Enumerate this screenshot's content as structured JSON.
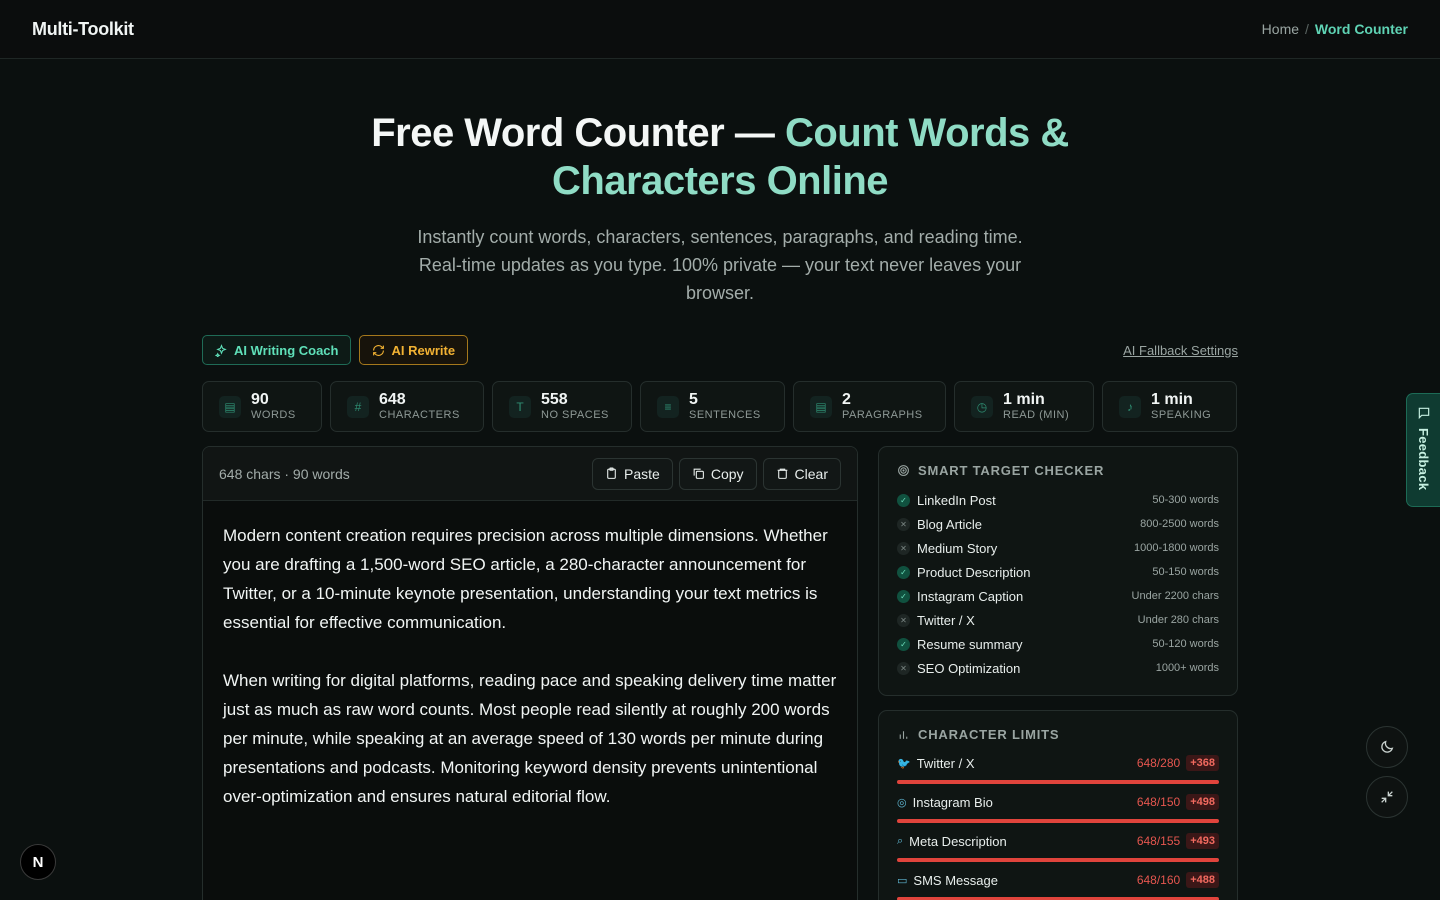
{
  "app": {
    "brand": "Multi-Toolkit"
  },
  "breadcrumb": {
    "home": "Home",
    "separator": "/",
    "current": "Word Counter"
  },
  "hero": {
    "title_main": "Free Word Counter — ",
    "title_accent": "Count Words & Characters Online",
    "subtitle": "Instantly count words, characters, sentences, paragraphs, and reading time. Real-time updates as you type. 100% private — your text never leaves your browser."
  },
  "actions": {
    "coach_label": "AI Writing Coach",
    "rewrite_label": "AI Rewrite",
    "fallback_label": "AI Fallback Settings"
  },
  "stats": [
    {
      "icon": "document-icon",
      "glyph": "▤",
      "value": "90",
      "label": "WORDS"
    },
    {
      "icon": "hash-icon",
      "glyph": "#",
      "value": "648",
      "label": "CHARACTERS"
    },
    {
      "icon": "type-icon",
      "glyph": "T",
      "value": "558",
      "label": "NO SPACES"
    },
    {
      "icon": "lines-icon",
      "glyph": "≡",
      "value": "5",
      "label": "SENTENCES"
    },
    {
      "icon": "paragraph-icon",
      "glyph": "▤",
      "value": "2",
      "label": "PARAGRAPHS"
    },
    {
      "icon": "clock-icon",
      "glyph": "◷",
      "value": "1 min",
      "label": "READ (MIN)"
    },
    {
      "icon": "mic-icon",
      "glyph": "♪",
      "value": "1 min",
      "label": "SPEAKING"
    }
  ],
  "editor": {
    "meta": "648 chars · 90 words",
    "paste_label": "Paste",
    "copy_label": "Copy",
    "clear_label": "Clear",
    "paragraphs": [
      "Modern content creation requires precision across multiple dimensions. Whether you are drafting a 1,500-word SEO article, a 280-character announcement for Twitter, or a 10-minute keynote presentation, understanding your text metrics is essential for effective communication.",
      "When writing for digital platforms, reading pace and speaking delivery time matter just as much as raw word counts. Most people read silently at roughly 200 words per minute, while speaking at an average speed of 130 words per minute during presentations and podcasts. Monitoring keyword density prevents unintentional over-optimization and ensures natural editorial flow."
    ]
  },
  "target_checker": {
    "title": "SMART TARGET CHECKER",
    "items": [
      {
        "name": "LinkedIn Post",
        "req": "50-300 words",
        "ok": true
      },
      {
        "name": "Blog Article",
        "req": "800-2500 words",
        "ok": false
      },
      {
        "name": "Medium Story",
        "req": "1000-1800 words",
        "ok": false
      },
      {
        "name": "Product Description",
        "req": "50-150 words",
        "ok": true
      },
      {
        "name": "Instagram Caption",
        "req": "Under 2200 chars",
        "ok": true
      },
      {
        "name": "Twitter / X",
        "req": "Under 280 chars",
        "ok": false
      },
      {
        "name": "Resume summary",
        "req": "50-120 words",
        "ok": true
      },
      {
        "name": "SEO Optimization",
        "req": "1000+ words",
        "ok": false
      }
    ]
  },
  "char_limits": {
    "title": "CHARACTER LIMITS",
    "items": [
      {
        "name": "Twitter / X",
        "icon": "twitter-icon",
        "glyph": "🐦",
        "ratio": "648/280",
        "over": "+368"
      },
      {
        "name": "Instagram Bio",
        "icon": "instagram-icon",
        "glyph": "◎",
        "ratio": "648/150",
        "over": "+498"
      },
      {
        "name": "Meta Description",
        "icon": "search-icon",
        "glyph": "⌕",
        "ratio": "648/155",
        "over": "+493"
      },
      {
        "name": "SMS Message",
        "icon": "message-icon",
        "glyph": "▭",
        "ratio": "648/160",
        "over": "+488"
      }
    ]
  },
  "feedback": {
    "label": "Feedback"
  },
  "colors": {
    "accent": "#5fd3b4",
    "warning": "#f2b233",
    "danger": "#e0443c",
    "background": "#0b100f"
  }
}
